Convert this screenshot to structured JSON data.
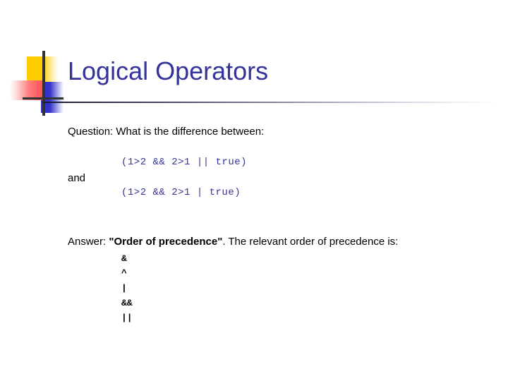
{
  "slide": {
    "title": "Logical Operators",
    "question": "Question: What is the difference between:",
    "expression_first": "(1>2 && 2>1 || true)",
    "conjunction": "and",
    "expression_second": "(1>2 && 2>1 | true)",
    "answer_prefix": "Answer: ",
    "answer_quoted_bold": "\"Order of precedence\"",
    "answer_suffix": ". The relevant order of precedence is:",
    "precedence": [
      "&",
      "^",
      "|",
      "&&",
      "||"
    ]
  },
  "theme": {
    "title_color": "#333399",
    "code_color": "#333399",
    "body_color": "#000000",
    "logo_yellow": "#ffcc00",
    "logo_blue": "#3333cc",
    "logo_red": "#ff4d4d",
    "logo_bar": "#333333",
    "background": "#ffffff"
  }
}
